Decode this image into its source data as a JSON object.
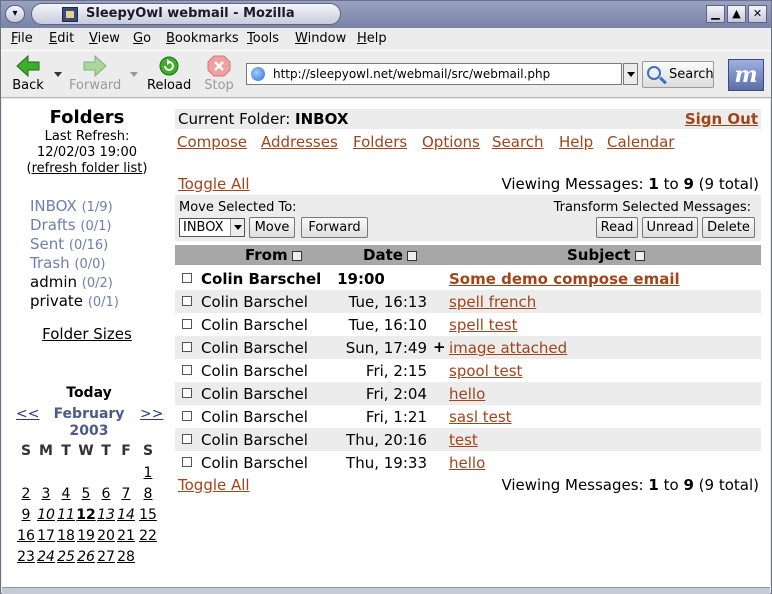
{
  "window": {
    "title": "SleepyOwl webmail - Mozilla"
  },
  "menubar": [
    "File",
    "Edit",
    "View",
    "Go",
    "Bookmarks",
    "Tools",
    "Window",
    "Help"
  ],
  "toolbar": {
    "back": "Back",
    "forward": "Forward",
    "reload": "Reload",
    "stop": "Stop",
    "url": "http://sleepyowl.net/webmail/src/webmail.php",
    "search": "Search"
  },
  "sidebar": {
    "title": "Folders",
    "last_refresh_label": "Last Refresh:",
    "last_refresh_value": "12/02/03 19:00",
    "refresh_link_open": "(",
    "refresh_link": "refresh folder list",
    "refresh_link_close": ")",
    "folders": [
      {
        "name": "INBOX",
        "count": "(1/9)"
      },
      {
        "name": "Drafts",
        "count": "(0/1)"
      },
      {
        "name": "Sent",
        "count": "(0/16)"
      },
      {
        "name": "Trash",
        "count": "(0/0)"
      },
      {
        "name": "admin",
        "count": "(0/2)"
      },
      {
        "name": "private",
        "count": "(0/1)"
      }
    ],
    "folder_sizes": "Folder Sizes"
  },
  "calendar": {
    "today": "Today",
    "prev": "<<",
    "next": ">>",
    "month": "February",
    "year": "2003",
    "weekdays": [
      "S",
      "M",
      "T",
      "W",
      "T",
      "F",
      "S"
    ],
    "weeks": [
      [
        "",
        "",
        "",
        "",
        "",
        "",
        "1"
      ],
      [
        "2",
        "3",
        "4",
        "5",
        "6",
        "7",
        "8"
      ],
      [
        "9",
        "10",
        "11",
        "12",
        "13",
        "14",
        "15"
      ],
      [
        "16",
        "17",
        "18",
        "19",
        "20",
        "21",
        "22"
      ],
      [
        "23",
        "24",
        "25",
        "26",
        "27",
        "28",
        ""
      ]
    ],
    "today_day": "12"
  },
  "main": {
    "current_folder_label": "Current Folder:",
    "current_folder": "INBOX",
    "sign_out": "Sign Out",
    "nav": [
      "Compose",
      "Addresses",
      "Folders",
      "Options",
      "Search",
      "Help",
      "Calendar"
    ],
    "toggle_all": "Toggle All",
    "viewing_label": "Viewing Messages:",
    "viewing_from": "1",
    "viewing_to_word": "to",
    "viewing_to": "9",
    "viewing_total": "(9 total)",
    "move_selected_label": "Move Selected To:",
    "move_target": "INBOX",
    "move_button": "Move",
    "forward_button": "Forward",
    "transform_label": "Transform Selected Messages:",
    "read_button": "Read",
    "unread_button": "Unread",
    "delete_button": "Delete",
    "columns": {
      "from": "From",
      "date": "Date",
      "subject": "Subject"
    },
    "messages": [
      {
        "from": "Colin Barschel",
        "date": "19:00",
        "flag": "",
        "subject": "Some demo compose email",
        "unread": true
      },
      {
        "from": "Colin Barschel",
        "date": "Tue, 16:13",
        "flag": "",
        "subject": "spell french",
        "unread": false
      },
      {
        "from": "Colin Barschel",
        "date": "Tue, 16:10",
        "flag": "",
        "subject": "spell test",
        "unread": false
      },
      {
        "from": "Colin Barschel",
        "date": "Sun, 17:49",
        "flag": "+",
        "subject": "image attached",
        "unread": false
      },
      {
        "from": "Colin Barschel",
        "date": "Fri, 2:15",
        "flag": "",
        "subject": "spool test",
        "unread": false
      },
      {
        "from": "Colin Barschel",
        "date": "Fri, 2:04",
        "flag": "",
        "subject": "hello",
        "unread": false
      },
      {
        "from": "Colin Barschel",
        "date": "Fri, 1:21",
        "flag": "",
        "subject": "sasl test",
        "unread": false
      },
      {
        "from": "Colin Barschel",
        "date": "Thu, 20:16",
        "flag": "",
        "subject": "test",
        "unread": false
      },
      {
        "from": "Colin Barschel",
        "date": "Thu, 19:33",
        "flag": "",
        "subject": "hello",
        "unread": false
      }
    ]
  }
}
